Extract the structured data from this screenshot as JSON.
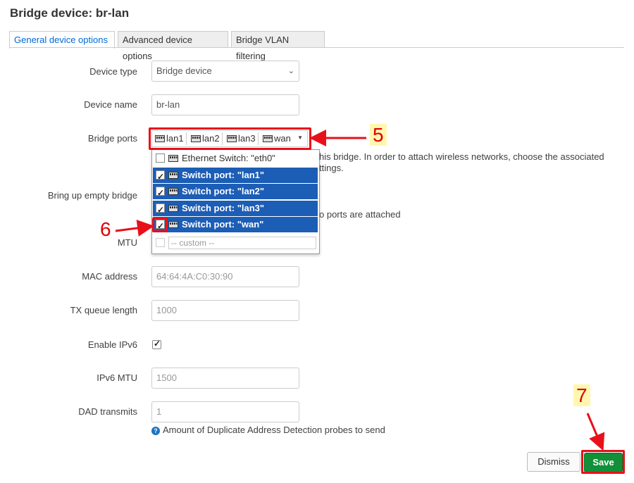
{
  "dialog": {
    "title": "Bridge device: br-lan"
  },
  "tabs": [
    {
      "label": "General device options",
      "active": true
    },
    {
      "label": "Advanced device options",
      "active": false
    },
    {
      "label": "Bridge VLAN filtering",
      "active": false
    }
  ],
  "fields": {
    "device_type": {
      "label": "Device type",
      "value": "Bridge device"
    },
    "device_name": {
      "label": "Device name",
      "value": "br-lan"
    },
    "bridge_ports": {
      "label": "Bridge ports",
      "selected": [
        "lan1",
        "lan2",
        "lan3",
        "wan"
      ],
      "description_line1": "his bridge. In order to attach wireless networks, choose the associated",
      "description_line2": "ttings."
    },
    "bring_up_empty": {
      "label": "Bring up empty bridge",
      "description": "o ports are attached"
    },
    "mtu": {
      "label": "MTU"
    },
    "mac_address": {
      "label": "MAC address",
      "placeholder": "64:64:4A:C0:30:90"
    },
    "tx_queue_length": {
      "label": "TX queue length",
      "placeholder": "1000"
    },
    "enable_ipv6": {
      "label": "Enable IPv6",
      "checked": true
    },
    "ipv6_mtu": {
      "label": "IPv6 MTU",
      "placeholder": "1500"
    },
    "dad_transmits": {
      "label": "DAD transmits",
      "placeholder": "1",
      "help": "Amount of Duplicate Address Detection probes to send"
    }
  },
  "dropdown": {
    "items": [
      {
        "label": "Ethernet Switch: \"eth0\"",
        "checked": false,
        "selected": false
      },
      {
        "label": "Switch port: \"lan1\"",
        "checked": true,
        "selected": true
      },
      {
        "label": "Switch port: \"lan2\"",
        "checked": true,
        "selected": true
      },
      {
        "label": "Switch port: \"lan3\"",
        "checked": true,
        "selected": true
      },
      {
        "label": "Switch port: \"wan\"",
        "checked": true,
        "selected": true
      }
    ],
    "custom_placeholder": "-- custom --"
  },
  "buttons": {
    "dismiss": "Dismiss",
    "save": "Save"
  },
  "annotations": {
    "step5": "5",
    "step6": "6",
    "step7": "7",
    "color": "#e8101a"
  },
  "colors": {
    "save_green": "#119038",
    "selection_blue": "#1c5db6",
    "tab_active_text": "#0069d6"
  },
  "icons": {
    "port": "ethernet-port-icon",
    "help": "question-circle-icon",
    "caret": "caret-down-icon"
  }
}
